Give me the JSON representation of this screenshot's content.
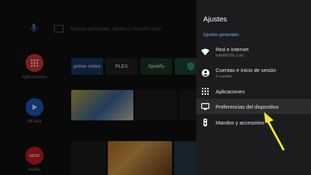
{
  "background": {
    "search_placeholder": "Busca películas, series y mucho más",
    "rail": [
      {
        "label": "Aplicaciones",
        "icon": "apps-grid-icon",
        "color": "#e53935"
      },
      {
        "label": "Mi lista",
        "icon": "play-icon",
        "color": "#1e63c8"
      },
      {
        "label": "Netflix",
        "icon": "netflix-logo",
        "color": "#d81f26"
      }
    ],
    "app_tiles": [
      {
        "name": "prime video",
        "color": "#1a3d6b"
      },
      {
        "name": "PLEX",
        "color": "#232323"
      },
      {
        "name": "Spotify",
        "color": "#1a3b24"
      },
      {
        "name": "",
        "color": "#1f4a3a"
      }
    ]
  },
  "panel": {
    "title": "Ajustes",
    "section": "Ajustes generales",
    "items": [
      {
        "label": "Red e Internet",
        "sub": "KAPIROTE 2.4G",
        "icon": "wifi-icon"
      },
      {
        "label": "Cuentas e inicio de sesión",
        "sub": "2 cuentas",
        "icon": "account-icon"
      },
      {
        "label": "Aplicaciones",
        "sub": "",
        "icon": "apps-icon"
      },
      {
        "label": "Preferencias del dispositivo",
        "sub": "",
        "icon": "tv-icon",
        "selected": true
      },
      {
        "label": "Mandos y accesorios",
        "sub": "",
        "icon": "remote-icon"
      }
    ]
  },
  "colors": {
    "accent": "#7fb3ff",
    "arrow": "#f2ea2a",
    "panel": "#1c1c1e"
  }
}
